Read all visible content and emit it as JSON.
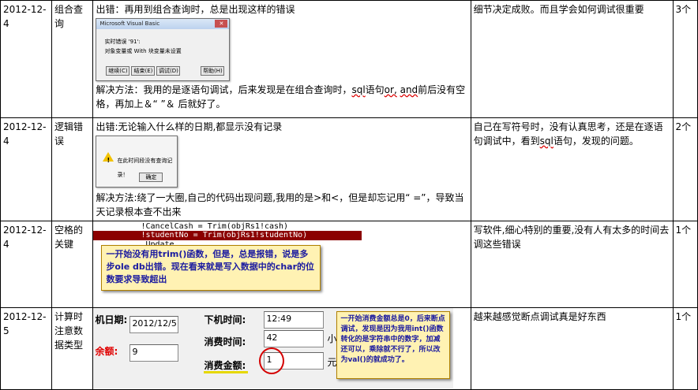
{
  "rows": [
    {
      "date": "2012-12-4",
      "type": "组合查询",
      "error_text": "出错：再用到组合查询时，总是出现这样的错误",
      "dialog": {
        "title": "Microsoft Visual Basic",
        "line1": "实时错误 '91':",
        "line2": "对象变量或 With 块变量未设置",
        "buttons": [
          "继续(C)",
          "结束(E)",
          "调试(D)",
          "帮助(H)"
        ]
      },
      "solution_pre": "解决方法：我用的是逐语句调试，后来发现是在组合查询时，",
      "solution_sql": "sql",
      "solution_mid": "语句",
      "solution_or": "or,",
      "solution_and": "and",
      "solution_post": "前后没有空格，再加上＆“ ”＆ 后就好了。",
      "lesson": "细节决定成败。而且学会如何调试很重要",
      "count": "3个"
    },
    {
      "date": "2012-12-4",
      "type": "逻辑错误",
      "error_text": "出错:无论输入什么样的日期,都显示没有记录",
      "dialog": {
        "line1": "在此时间段没有查询记录！",
        "ok": "确定"
      },
      "solution": "解决方法:绕了一大圈,自己的代码出现问题,我用的是>和<，但是却忘记用“ =”，导致当天记录根本查不出来",
      "lesson_pre": "自己在写符号时，没有认真思考，还是在逐语句调试中，看到",
      "lesson_sql": "sql",
      "lesson_post": "语句，发现的问题。",
      "count": "2个"
    },
    {
      "date": "2012-12-4",
      "type": "空格的关键",
      "code": [
        "!CancelCash = Trim(objRs1!cash)",
        "!studentNo = Trim(objRs1!studentNo)",
        ".Update"
      ],
      "note": "一开始没有用trim()函数，但是，总是报错，说是多步ole db出错。现在看来就是写入数据中的char的位数要求导致超出",
      "lesson": "写软件,细心特别的重要,没有人有太多的时间去调这些错误",
      "count": "1个"
    },
    {
      "date": "2012-12-5",
      "type": "计算时注意数据类型",
      "form": {
        "date_label": "机日期:",
        "date_value": "2012/12/5",
        "amount_label": "余额:",
        "amount_value": "9",
        "offtime_label": "下机时间:",
        "offtime_value": "12:49",
        "time_label": "消费时间:",
        "time_value": "42",
        "money_label": "消费金额:",
        "money_value": "1",
        "unit_small": "小",
        "unit_yuan": "元"
      },
      "note": "一开始消费金额总是0，后来断点调试，发现是因为我用int()函数转化的是字符串中的数字，加减还可以，乘除就不行了，所以改为val()的就成功了。",
      "lesson": "越来越感觉断点调试真是好东西",
      "count": "1个"
    }
  ],
  "colors": {
    "note_text": "#1a1aa0",
    "note_bg": "#fff2b3",
    "code_highlight": "#8b0000",
    "amount_red": "#e00000",
    "circle_red": "#d40000"
  }
}
